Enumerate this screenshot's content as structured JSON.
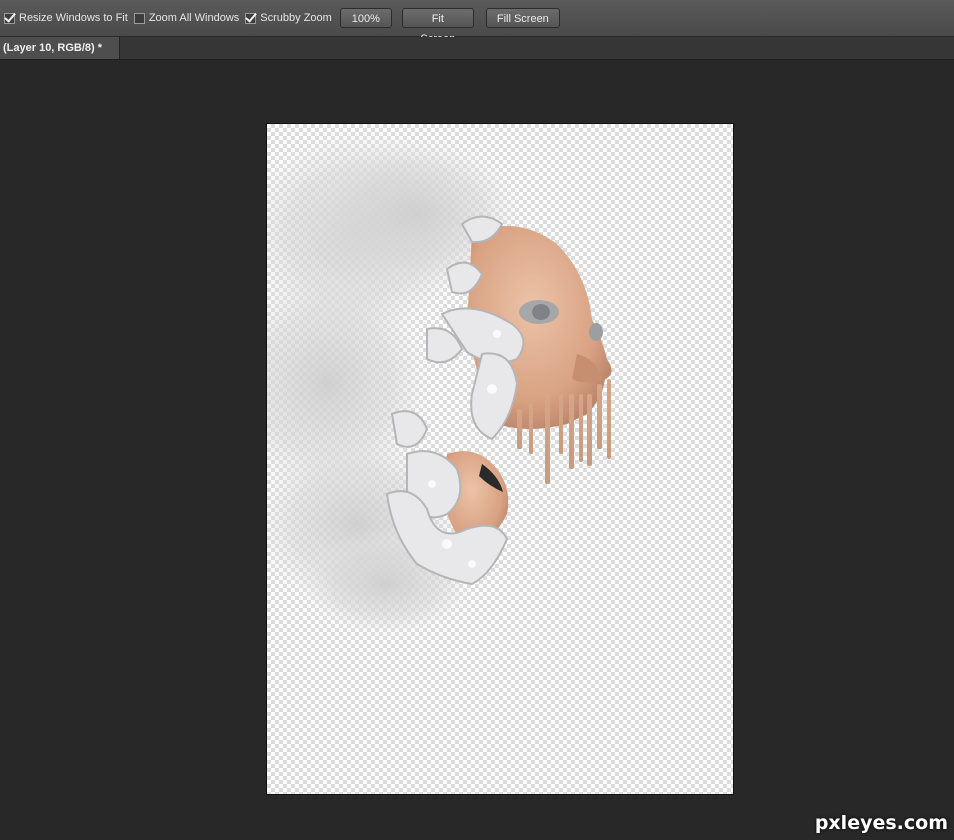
{
  "options_bar": {
    "resize_windows": {
      "label": "Resize Windows to Fit",
      "checked": true
    },
    "zoom_all": {
      "label": "Zoom All Windows",
      "checked": false
    },
    "scrubby_zoom": {
      "label": "Scrubby Zoom",
      "checked": true
    },
    "zoom_level": "100%",
    "fit_screen": "Fit Screen",
    "fill_screen": "Fill Screen"
  },
  "document_tab": {
    "title": "(Layer 10, RGB/8) *"
  },
  "watermark": "pxleyes.com",
  "colors": {
    "options_bar_bg": "#4f4f4f",
    "workspace_bg": "#282828",
    "transparency_checker": "#dcdcdc"
  }
}
